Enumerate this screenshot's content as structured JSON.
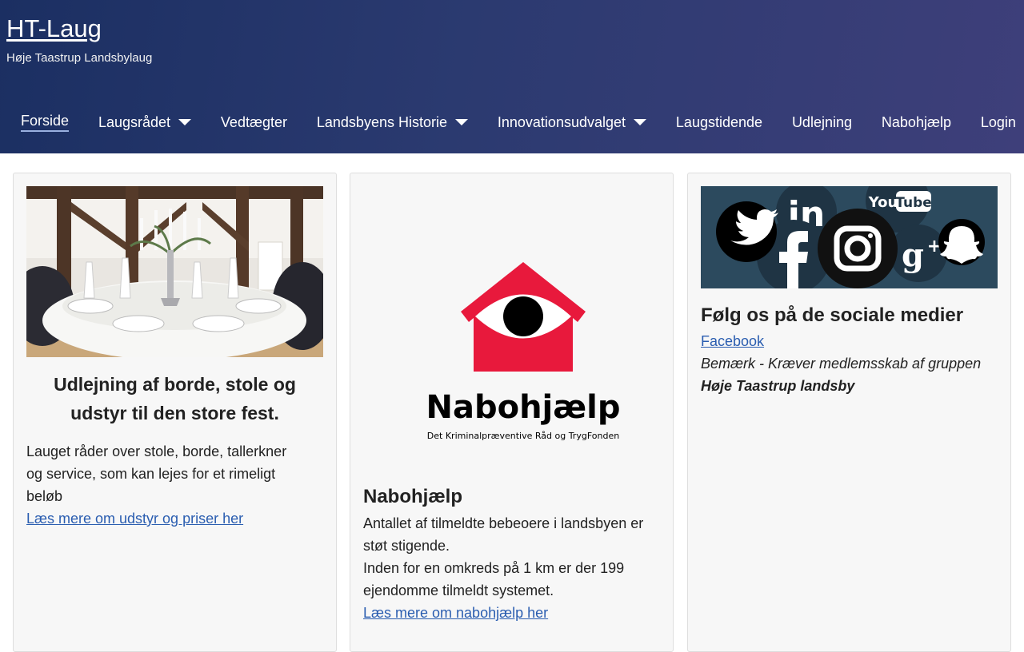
{
  "header": {
    "title": "HT-Laug",
    "tagline": "Høje Taastrup Landsbylaug"
  },
  "nav": {
    "items": [
      {
        "label": "Forside"
      },
      {
        "label": "Laugsrådet"
      },
      {
        "label": "Vedtægter"
      },
      {
        "label": "Landsbyens Historie"
      },
      {
        "label": "Innovationsudvalget"
      },
      {
        "label": "Laugstidende"
      },
      {
        "label": "Udlejning"
      },
      {
        "label": "Nabohjælp"
      },
      {
        "label": "Login"
      }
    ]
  },
  "cards": [
    {
      "heading": "Udlejning af borde, stole og udstyr til den store fest.",
      "text": "Lauget råder over stole, borde, tallerkner og service, som kan lejes for et rimeligt beløb",
      "link": "Læs mere om udstyr og priser her"
    },
    {
      "logo_word": "Nabohjælp",
      "logo_sub": "Det Kriminalpræventive Råd og TrygFonden",
      "heading": "Nabohjælp",
      "line1": "Antallet af tilmeldte bebeoere i landsbyen er støt stigende.",
      "line2": "Inden for en omkreds på 1 km er der 199 ejendomme tilmeldt systemet.",
      "link": "Læs mere om nabohjælp her"
    },
    {
      "social_youtube": "You",
      "social_youtube2": "Tube",
      "heading": "Følg os på de sociale medier",
      "link": "Facebook",
      "note_prefix": "Bemærk - Kræver medlemsskab af gruppen ",
      "note_bold": "Høje Taastrup landsby"
    }
  ],
  "colors": {
    "header_start": "#1b2f62",
    "header_end": "#3e3f7a",
    "link": "#2a5db0",
    "nabo_red": "#e8193c",
    "social_bg": "#2c4a5e"
  }
}
